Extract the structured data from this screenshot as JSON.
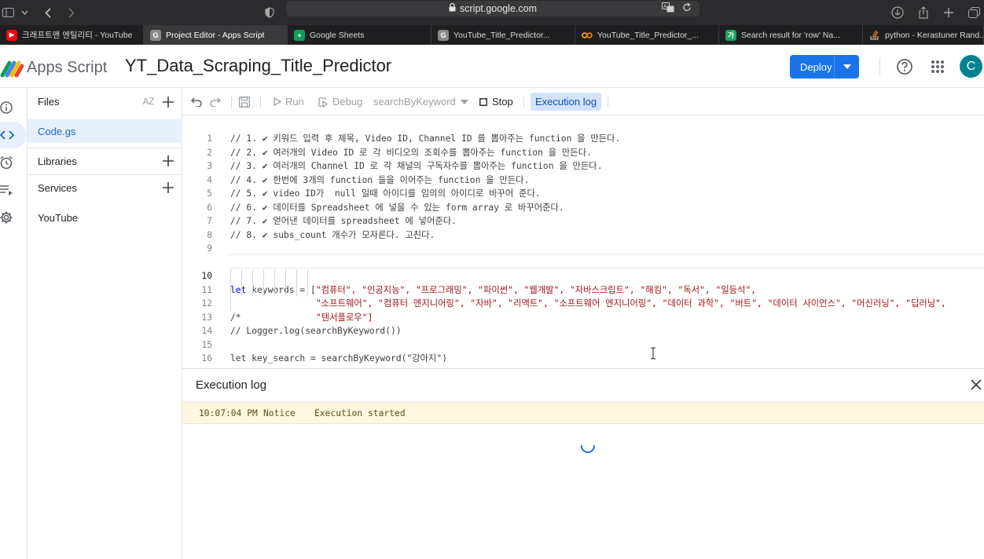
{
  "browser": {
    "url": "script.google.com",
    "tabs": [
      {
        "label": "크래프트맨 엔틸리티 - YouTube",
        "icon": "youtube-icon",
        "color": "#ff0000"
      },
      {
        "label": "Project Editor - Apps Script",
        "icon": "google-g-icon",
        "color": "#8a8a8a",
        "active": true
      },
      {
        "label": "Google Sheets",
        "icon": "sheets-icon",
        "color": "#0f9d58"
      },
      {
        "label": "YouTube_Title_Predictor...",
        "icon": "google-g-icon",
        "color": "#8a8a8a"
      },
      {
        "label": "YouTube_Title_Predictor_...",
        "icon": "colab-icon",
        "color": "#f9ab00"
      },
      {
        "label": "Search result for 'row' Na...",
        "icon": "search-result-icon",
        "color": "#1ea362"
      },
      {
        "label": "python - Kerastuner Rand...",
        "icon": "stackoverflow-icon",
        "color": "#f48024"
      }
    ]
  },
  "header": {
    "app_name": "Apps Script",
    "project_title": "YT_Data_Scraping_Title_Predictor",
    "deploy_label": "Deploy",
    "avatar_letter": "C",
    "accent": "#1a73e8"
  },
  "files_panel": {
    "files_label": "Files",
    "sort_label": "AZ",
    "files": [
      "Code.gs"
    ],
    "libraries_label": "Libraries",
    "services_label": "Services",
    "services": [
      "YouTube"
    ]
  },
  "toolbar": {
    "run_label": "Run",
    "debug_label": "Debug",
    "function_name": "searchByKeyword",
    "stop_label": "Stop",
    "execlog_label": "Execution log"
  },
  "editor": {
    "current_line": 10,
    "lines": [
      {
        "n": "1",
        "text": "// 1. ✔ 키워드 입력 후 제목, Video ID, Channel ID 를 뽑아주는 function 을 만든다."
      },
      {
        "n": "2",
        "text": "// 2. ✔ 여러개의 Video ID 로 각 비디오의 조회수를 뽑아주는 function 을 만든다."
      },
      {
        "n": "3",
        "text": "// 3. ✔ 여러개의 Channel ID 로 각 채널의 구독자수를 뽑아주는 function 을 만든다."
      },
      {
        "n": "4",
        "text": "// 4. ✔ 한번에 3개의 function 들을 이어주는 function 을 만든다."
      },
      {
        "n": "5",
        "text": "// 5. ✔ video ID가  null 일때 아이디를 임의의 아이디로 바꾸어 준다."
      },
      {
        "n": "6",
        "text": "// 6. ✔ 데이터를 Spreadsheet 에 넣을 수 있는 form array 로 바꾸어준다."
      },
      {
        "n": "7",
        "text": "// 7. ✔ 얻어낸 데이터를 spreadsheet 에 넣어준다."
      },
      {
        "n": "8",
        "text": "// 8. ✔ subs_count 개수가 모자른다. 고친다."
      },
      {
        "n": "9",
        "text": ""
      },
      {
        "n": "10",
        "kw": "let",
        "rest": " keywords = [",
        "strs": "\"컴퓨터\", \"인공지능\", \"프로그래밍\", \"파이썬\", \"웹개발\", \"자바스크립트\", \"해킹\", \"독서\", \"일등석\","
      },
      {
        "n": "11",
        "strs": "\"소프트웨어\", \"컴퓨터 엔지니어링\", \"자바\", \"리액트\", \"소프트웨어 엔지니어링\", \"데이터 과학\", \"버트\", \"데이터 사이언스\", \"머신러닝\", \"딥러닝\","
      },
      {
        "n": "",
        "strs": "\"텐서플로우\"]"
      },
      {
        "n": "12",
        "text": ""
      },
      {
        "n": "13",
        "text": "/*"
      },
      {
        "n": "14",
        "text": "// Logger.log(searchByKeyword())"
      },
      {
        "n": "15",
        "text": ""
      },
      {
        "n": "16",
        "text": "let key_search = searchByKeyword(\"강아지\")"
      }
    ]
  },
  "execution_log": {
    "title": "Execution log",
    "entries": [
      {
        "time": "10:07:04 PM",
        "level": "Notice",
        "message": "Execution started"
      }
    ]
  }
}
